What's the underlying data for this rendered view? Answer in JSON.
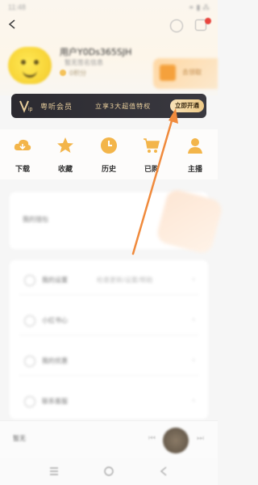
{
  "status_bar": {
    "time": "11:48",
    "icons": "⚭ ▮ ⁂"
  },
  "profile": {
    "username": "用户Y0Ds365SJH",
    "subtitle": "暂无签名信息",
    "badge_text": "0积分"
  },
  "promo": {
    "text": "去领取"
  },
  "vip": {
    "logo_text": "VIP",
    "label": "粤听会员",
    "promo": "立享3大超值特权",
    "button": "立即开通",
    "colors": {
      "bar": "#2b2a30",
      "gold": "#e9cf9d"
    }
  },
  "quick_actions": [
    {
      "label": "下载",
      "icon": "cloud-download-icon"
    },
    {
      "label": "收藏",
      "icon": "star-icon"
    },
    {
      "label": "历史",
      "icon": "clock-icon"
    },
    {
      "label": "已购",
      "icon": "cart-icon"
    },
    {
      "label": "主播",
      "icon": "user-icon"
    }
  ],
  "block1_text": "我的钱包",
  "list_items": [
    {
      "label": "我的设置",
      "extra": "检查更新/设置/帮助"
    },
    {
      "label": "小红书心",
      "extra": ""
    },
    {
      "label": "我的优惠",
      "extra": ""
    },
    {
      "label": "联系客服",
      "extra": ""
    }
  ],
  "player": {
    "label": "暂无",
    "prev": "⏮",
    "next": "⏭"
  },
  "accent_arrow_color": "#f08a3c"
}
